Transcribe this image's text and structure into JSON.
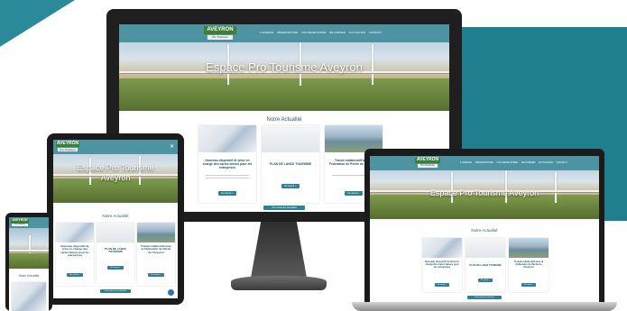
{
  "site": {
    "logo_top": "AVEYRON",
    "logo_sub": "Pro Tourisme",
    "hero_title": "Espace Pro Tourisme Aveyron",
    "hero_title_line1": "Espace Pro Tourisme",
    "hero_title_line2": "Aveyron",
    "menu": [
      "L'AGENCE",
      "OBSERVATOIRE",
      "VOS DEVELOPPER",
      "SE FORMER",
      "ACTUALITES",
      "CONTACT"
    ],
    "section_title": "Notre Actualité",
    "cards": [
      {
        "title": "Nouveau dispositif de prise en charge des cartes bleues pour les entreprises",
        "button": "En savoir +"
      },
      {
        "title": "PLAN DE LANCE TOURISME",
        "button": "En savoir +"
      },
      {
        "title": "Travail collaboratif avec la Fédération de Pêche de l'Aveyron",
        "button": "En savoir +"
      }
    ],
    "more_button": "Voir toutes les actualités"
  },
  "colors": {
    "teal": "#1f7f8f",
    "nav": "#4c94a1",
    "button": "#2d8096",
    "logo_green": "#3d7f34"
  }
}
